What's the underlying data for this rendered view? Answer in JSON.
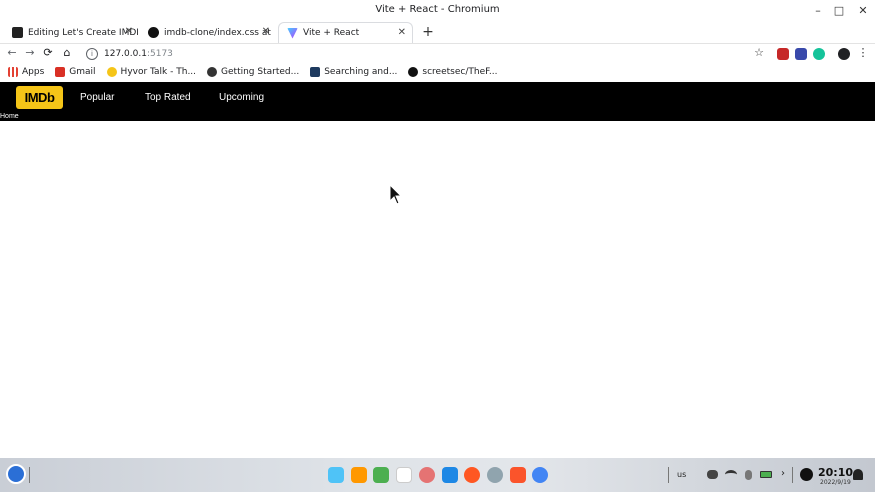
{
  "window": {
    "title": "Vite + React - Chromium",
    "controls": {
      "minimize": "–",
      "maximize": "□",
      "close": "✕"
    }
  },
  "tabs": [
    {
      "label": "Editing Let's Create IMDB",
      "close": "✕",
      "favicon_color": "#222222"
    },
    {
      "label": "imdb-clone/index.css at m",
      "close": "✕",
      "favicon_color": "#111111"
    },
    {
      "label": "Vite + React",
      "close": "✕",
      "favicon_color": "#8c6cf2",
      "active": true
    }
  ],
  "new_tab": "+",
  "toolbar": {
    "back": "←",
    "forward": "→",
    "reload": "⟳",
    "home": "⌂",
    "url_host": "127.0.0.1",
    "url_port": ":5173",
    "star": "☆",
    "menu": "⋮"
  },
  "bookmarks": [
    {
      "label": "Apps",
      "icon": "apps-grid-icon",
      "color": "#e34133"
    },
    {
      "label": "Gmail",
      "icon": "gmail-icon",
      "color": "#d93025"
    },
    {
      "label": "Hyvor Talk - Th...",
      "icon": "hyvor-icon",
      "color": "#f5c518"
    },
    {
      "label": "Getting Started...",
      "icon": "globe-icon",
      "color": "#333333"
    },
    {
      "label": "Searching and...",
      "icon": "algolia-icon",
      "color": "#1e3a5f"
    },
    {
      "label": "screetsec/TheF...",
      "icon": "github-icon",
      "color": "#111111"
    }
  ],
  "app": {
    "logo": "IMDb",
    "nav": [
      "Popular",
      "Top Rated",
      "Upcoming"
    ],
    "home_label": "Home",
    "colors": {
      "header_bg": "#000000",
      "logo_bg": "#f5c518"
    }
  },
  "taskbar": {
    "tray_lang": "us",
    "clock_time": "20:10",
    "clock_date": "2022/9/19"
  }
}
